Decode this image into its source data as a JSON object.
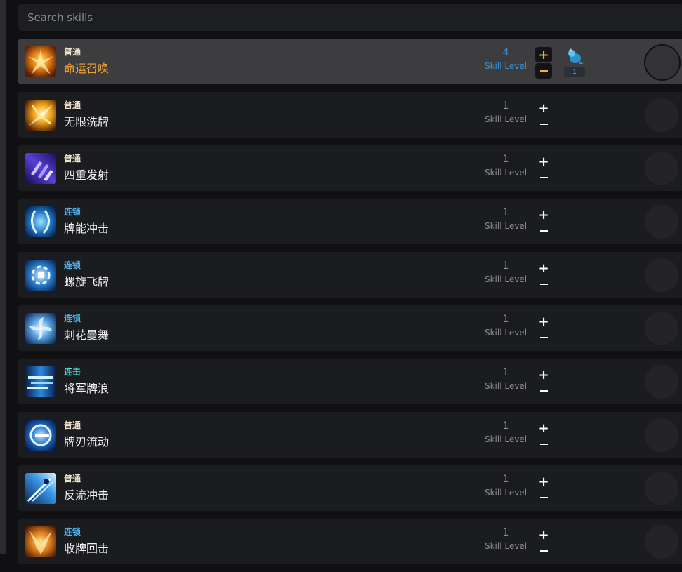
{
  "search": {
    "placeholder": "Search skills"
  },
  "level_label": "Skill Level",
  "skills": [
    {
      "type": "普通",
      "name": "命运召唤",
      "level": "4",
      "selected": true,
      "spirit_count": "1"
    },
    {
      "type": "普通",
      "name": "无限洗牌",
      "level": "1"
    },
    {
      "type": "普通",
      "name": "四重发射",
      "level": "1"
    },
    {
      "type": "连锁",
      "name": "牌能冲击",
      "level": "1"
    },
    {
      "type": "连锁",
      "name": "螺旋飞牌",
      "level": "1"
    },
    {
      "type": "连锁",
      "name": "刺花曼舞",
      "level": "1"
    },
    {
      "type": "连击",
      "name": "将军牌浪",
      "level": "1"
    },
    {
      "type": "普通",
      "name": "牌刃流动",
      "level": "1"
    },
    {
      "type": "普通",
      "name": "反流冲击",
      "level": "1"
    },
    {
      "type": "连锁",
      "name": "收牌回击",
      "level": "1"
    }
  ],
  "icons": [
    "fate-summon-icon",
    "infinite-shuffle-icon",
    "quad-shot-icon",
    "card-energy-strike-icon",
    "spiral-cards-icon",
    "thorn-flower-dance-icon",
    "general-card-wave-icon",
    "card-blade-flow-icon",
    "counterflow-strike-icon",
    "card-recall-icon"
  ],
  "colors": {
    "normal_type": "#ece3c6",
    "chain_type": "#4fb2e6",
    "combo_type": "#4fd6d6",
    "selected_name": "#f0a132",
    "selected_level": "#3b92d8"
  }
}
